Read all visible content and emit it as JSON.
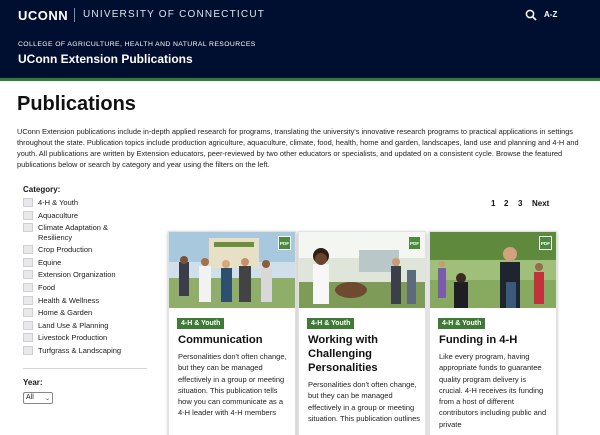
{
  "topbar": {
    "logo": "UCONN",
    "university": "UNIVERSITY OF CONNECTICUT",
    "az_label": "A-Z",
    "search_icon": "search-icon"
  },
  "subheader": {
    "college": "COLLEGE OF AGRICULTURE, HEALTH AND NATURAL RESOURCES",
    "site_title": "UConn Extension Publications"
  },
  "main": {
    "title": "Publications",
    "intro": "UConn Extension publications include in-depth applied research for programs, translating the university's innovative research programs to practical applications in settings throughout the state. Publication topics include production agriculture, aquaculture, climate, food, health, home and garden, landscapes, land use and planning and 4-H and youth. All publications are written by Extension educators, peer-reviewed by two other educators or specialists, and updated on a consistent cycle. Browse the featured publications below or search by category and year using the filters on the left."
  },
  "filters": {
    "category_heading": "Category:",
    "categories": [
      "4-H & Youth",
      "Aquaculture",
      "Climate Adaptation & Resiliency",
      "Crop Production",
      "Equine",
      "Extension Organization",
      "Food",
      "Health & Wellness",
      "Home & Garden",
      "Land Use & Planning",
      "Livestock Production",
      "Turfgrass & Landscaping"
    ],
    "year_heading": "Year:",
    "year_value": "All"
  },
  "pagination": {
    "pages": [
      "1",
      "2",
      "3"
    ],
    "next": "Next",
    "current": "1"
  },
  "cards": [
    {
      "tag": "4-H & Youth",
      "title": "Communication",
      "badge": "PDF",
      "description": "Personalities don't often change, but they can be managed effectively in a group or meeting situation. This publication tells how you can communicate as a 4-H leader with 4-H members"
    },
    {
      "tag": "4-H & Youth",
      "title": "Working with Challenging Personalities",
      "badge": "PDF",
      "description": "Personalities don't often change, but they can be managed effectively in a group or meeting situation. This publication outlines"
    },
    {
      "tag": "4-H & Youth",
      "title": "Funding in 4-H",
      "badge": "PDF",
      "description": "Like every program, having appropriate funds to guarantee quality program delivery is crucial. 4-H receives its funding from a host of different contributors including public and private"
    }
  ],
  "colors": {
    "navy": "#000e2f",
    "green_rule": "#2f7d32",
    "tag_green": "#3f7b36"
  }
}
